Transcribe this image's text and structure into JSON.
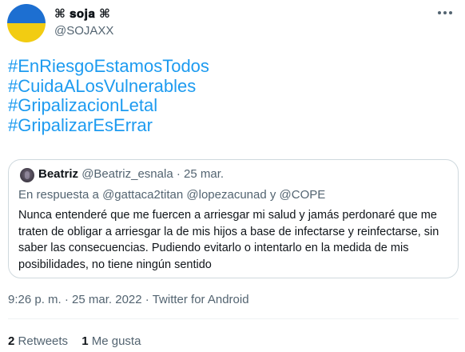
{
  "author": {
    "display_name": "⌘ 𝐬𝐨𝐣𝐚 ⌘",
    "handle": "@SOJAXX",
    "avatar_colors": [
      "#1d6fd1",
      "#f2cc12"
    ]
  },
  "tweet": {
    "hashtags": [
      "#EnRiesgoEstamosTodos",
      "#CuidaALosVulnerables",
      "#GripalizacionLetal",
      "#GripalizarEsErrar"
    ],
    "time": "9:26 p. m.",
    "date": "25 mar. 2022",
    "source": "Twitter for Android",
    "separator": "·"
  },
  "quote": {
    "name": "Beatriz",
    "handle": "@Beatriz_esnala",
    "date": "25 mar.",
    "separator": "·",
    "reply_prefix": "En respuesta a",
    "reply_mention_1": "@gattaca2titan",
    "reply_mention_2": "@lopezacunad",
    "reply_conj": "y",
    "reply_mention_3": "@COPE",
    "text": "Nunca entenderé que me fuercen a arriesgar mi salud y jamás perdonaré que me traten de obligar a arriesgar la de mis hijos a base de infectarse y reinfectarse, sin saber las consecuencias. Pudiendo evitarlo o intentarlo en la medida de mis posibilidades, no tiene ningún sentido"
  },
  "stats": {
    "retweets_count": "2",
    "retweets_label": "Retweets",
    "likes_count": "1",
    "likes_label": "Me gusta"
  },
  "colors": {
    "link": "#1d9bf0",
    "secondary_text": "#536471",
    "border": "#cfd9de"
  },
  "icons": {
    "more": "more-horizontal-icon"
  }
}
